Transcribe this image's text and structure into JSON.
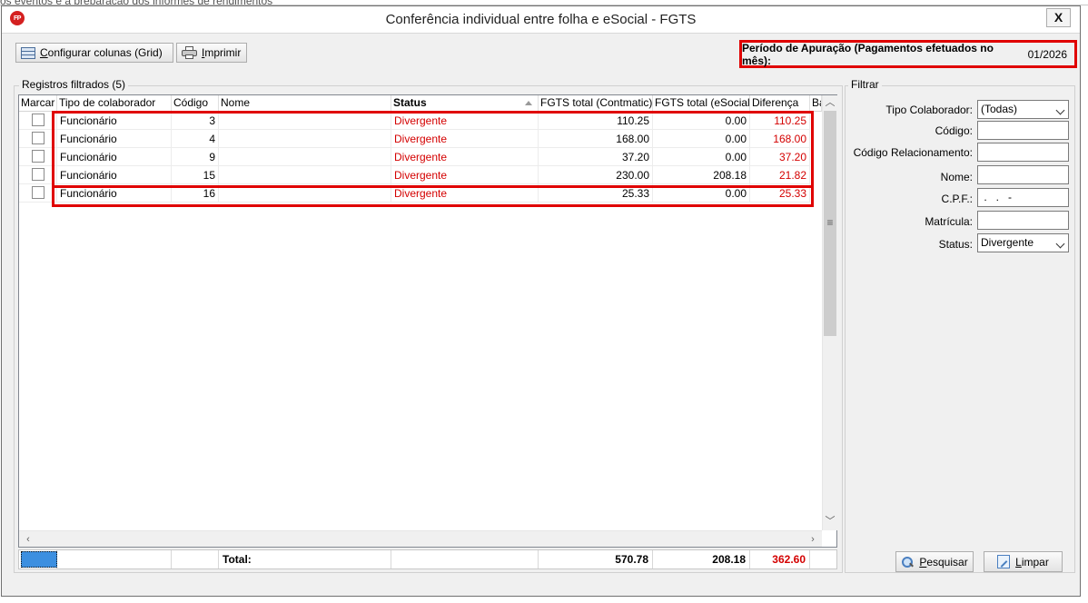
{
  "background_text": "os eventos e a preparação dos informes de rendimentos",
  "window": {
    "icon_text": "FP",
    "title": "Conferência individual entre folha e eSocial - FGTS",
    "close_label": "X"
  },
  "toolbar": {
    "configure_prefix": "C",
    "configure_rest": "onfigurar colunas (Grid)",
    "print_prefix": "I",
    "print_rest": "mprimir"
  },
  "periodo": {
    "label": "Período de Apuração (Pagamentos efetuados no mês):",
    "value": "01/2026"
  },
  "registros": {
    "group_label": "Registros filtrados (5)",
    "columns": [
      "Marcar",
      "Tipo de colaborador",
      "Código",
      "Nome",
      "Status",
      "FGTS total (Contmatic)",
      "FGTS total (eSocial)",
      "Diferença",
      "Ba"
    ],
    "rows": [
      {
        "tipo": "Funcionário",
        "codigo": "3",
        "nome": "",
        "status": "Divergente",
        "contmatic": "110.25",
        "esocial": "0.00",
        "diferenca": "110.25"
      },
      {
        "tipo": "Funcionário",
        "codigo": "4",
        "nome": "",
        "status": "Divergente",
        "contmatic": "168.00",
        "esocial": "0.00",
        "diferenca": "168.00"
      },
      {
        "tipo": "Funcionário",
        "codigo": "9",
        "nome": "",
        "status": "Divergente",
        "contmatic": "37.20",
        "esocial": "0.00",
        "diferenca": "37.20"
      },
      {
        "tipo": "Funcionário",
        "codigo": "15",
        "nome": "",
        "status": "Divergente",
        "contmatic": "230.00",
        "esocial": "208.18",
        "diferenca": "21.82"
      },
      {
        "tipo": "Funcionário",
        "codigo": "16",
        "nome": "",
        "status": "Divergente",
        "contmatic": "25.33",
        "esocial": "0.00",
        "diferenca": "25.33"
      }
    ],
    "totals": {
      "label": "Total:",
      "contmatic": "570.78",
      "esocial": "208.18",
      "diferenca": "362.60"
    }
  },
  "filtrar": {
    "group_label": "Filtrar",
    "tipo_colaborador_label": "Tipo Colaborador:",
    "tipo_colaborador_value": "(Todas)",
    "codigo_label": "Código:",
    "codigo_value": "",
    "codigo_relacionamento_label": "Código Relacionamento:",
    "codigo_relacionamento_value": "",
    "nome_label": "Nome:",
    "nome_value": "",
    "cpf_label": "C.P.F.:",
    "cpf_value": " .   .   -",
    "matricula_label": "Matrícula:",
    "matricula_value": "",
    "status_label": "Status:",
    "status_value": "Divergente",
    "search_prefix": "P",
    "search_rest": "esquisar",
    "clear_prefix": "L",
    "clear_rest": "impar"
  },
  "colors": {
    "divergent": "#d40000",
    "highlight_border": "#e00000",
    "selection": "#3c8fe0"
  }
}
